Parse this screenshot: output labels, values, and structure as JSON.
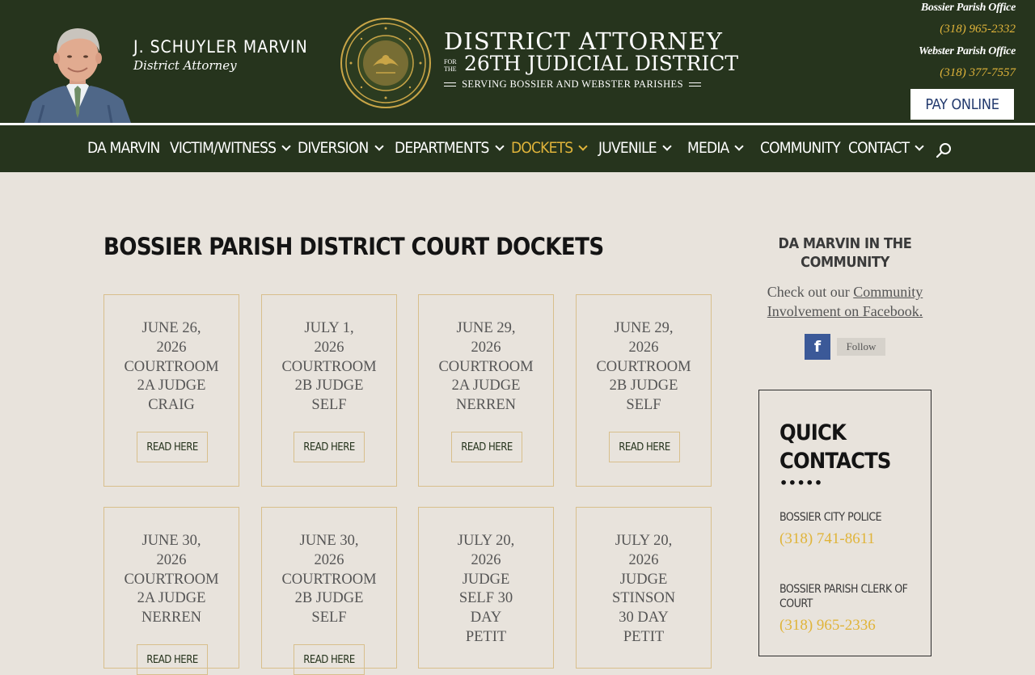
{
  "header": {
    "da_name": "J. SCHUYLER MARVIN",
    "da_title": "District Attorney",
    "logo": {
      "line1": "DISTRICT ATTORNEY",
      "for_the": "FOR THE",
      "line2": "26TH JUDICIAL DISTRICT",
      "line3": "SERVING BOSSIER AND WEBSTER PARISHES",
      "seal_text": "DISTRICT ATTORNEY'S OFFICE · BOSSIER-WEBSTER PARISHES · STATE OF LOUISIANA"
    },
    "offices": [
      {
        "name": "Bossier Parish Office",
        "phone": "(318) 965-2332"
      },
      {
        "name": "Webster Parish Office",
        "phone": "(318) 377-7557"
      }
    ],
    "pay_online": "PAY ONLINE"
  },
  "nav": {
    "items": [
      {
        "label": "DA MARVIN",
        "dropdown": false
      },
      {
        "label": "VICTIM/WITNESS",
        "dropdown": true
      },
      {
        "label": "DIVERSION",
        "dropdown": true
      },
      {
        "label": "DEPARTMENTS",
        "dropdown": true
      },
      {
        "label": "DOCKETS",
        "dropdown": true,
        "active": true
      },
      {
        "label": "JUVENILE",
        "dropdown": true
      },
      {
        "label": "MEDIA",
        "dropdown": true
      },
      {
        "label": "COMMUNITY",
        "dropdown": false
      },
      {
        "label": "CONTACT",
        "dropdown": true
      }
    ],
    "search_icon": "search-icon"
  },
  "main": {
    "title": "BOSSIER PARISH DISTRICT COURT DOCKETS",
    "read_label": "READ HERE",
    "dockets": [
      {
        "lines": [
          "JUNE 26,",
          "2026",
          "COURTROOM",
          "2A JUDGE",
          "CRAIG"
        ]
      },
      {
        "lines": [
          "JULY 1,",
          "2026",
          "COURTROOM",
          "2B JUDGE",
          "SELF"
        ]
      },
      {
        "lines": [
          "JUNE 29,",
          "2026",
          "COURTROOM",
          "2A JUDGE",
          "NERREN"
        ]
      },
      {
        "lines": [
          "JUNE 29,",
          "2026",
          "COURTROOM",
          "2B JUDGE",
          "SELF"
        ]
      },
      {
        "lines": [
          "JUNE 30,",
          "2026",
          "COURTROOM",
          "2A JUDGE",
          "NERREN"
        ]
      },
      {
        "lines": [
          "JUNE 30,",
          "2026",
          "COURTROOM",
          "2B JUDGE",
          "SELF"
        ]
      },
      {
        "lines": [
          "JULY 20,",
          "2026",
          "JUDGE",
          "SELF 30",
          "DAY",
          "PETIT"
        ]
      },
      {
        "lines": [
          "JULY 20,",
          "2026",
          "JUDGE",
          "STINSON",
          "30 DAY",
          "PETIT"
        ]
      }
    ]
  },
  "sidebar": {
    "community_title": "DA MARVIN IN THE COMMUNITY",
    "community_text": "Check out our",
    "community_link": "Community Involvement on Facebook.",
    "facebook_icon": "facebook-icon",
    "follow_label": "Follow",
    "quick_contacts_title": "QUICK CONTACTS",
    "contacts": [
      {
        "name": "BOSSIER CITY POLICE",
        "phone": "(318) 741-8611"
      },
      {
        "name": "BOSSIER PARISH CLERK OF COURT",
        "phone": "(318) 965-2336"
      }
    ]
  },
  "colors": {
    "header_green": "#26341d",
    "gold": "#e0b43a",
    "page_bg": "#e8e3dc",
    "card_border": "#d8bf8c",
    "pay_text": "#233a6e",
    "facebook_blue": "#3b5998"
  }
}
